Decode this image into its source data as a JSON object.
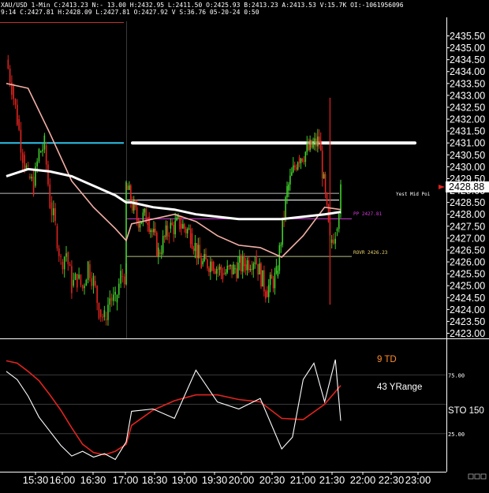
{
  "header": {
    "line1": "XAU/USD  1-Min  C:2413.23  N:- 13.00  H:2432.95  L:2411.50  O:2425.93  B:2413.23  A:2413.53  V:15.7K  OI:-1061956096",
    "line2": "9:14  C:2427.81  H:2428.09  L:2427.81  O:2427.92  V  S:36.76  05-20-24  0:50"
  },
  "price_axis": {
    "ticks": [
      "2423.00",
      "2423.50",
      "2424.00",
      "2424.50",
      "2425.00",
      "2425.50",
      "2426.00",
      "2426.50",
      "2427.00",
      "2427.50",
      "2428.00",
      "2428.50",
      "2429.00",
      "2429.50",
      "2430.00",
      "2430.50",
      "2431.00",
      "2431.50",
      "2432.00",
      "2432.50",
      "2433.00",
      "2433.50",
      "2434.00",
      "2434.50",
      "2435.00",
      "2435.50"
    ],
    "current_price": "2428.88"
  },
  "time_axis": {
    "ticks": [
      "15:30",
      "16:00",
      "16:30",
      "17:00",
      "18:30",
      "19:00",
      "19:30",
      "20:00",
      "20:30",
      "21:00",
      "21:30",
      "22:00",
      "22:30",
      "23:00"
    ]
  },
  "annotations": {
    "yest_mid": "Yest Mid Poi",
    "pp": "PP 2427.81",
    "rovr": "ROVR 2426.23",
    "td": "9 TD",
    "yrange": "43 YRange",
    "sto": "STO  150"
  },
  "oscillator_axis": {
    "ticks": [
      "75.00",
      "25.00"
    ]
  },
  "colors": {
    "up": "#3fcf2c",
    "down": "#e0241f",
    "ma_slow": "#ffffff",
    "ma_fast": "#f4b0a6",
    "cyan_level": "#2fc2e8",
    "pp_level": "#d13bd6",
    "td_label": "#ff8c28"
  },
  "chart_data": [
    {
      "type": "line",
      "symbol": "XAU/USD",
      "interval": "1-Min",
      "ylim": [
        2423.0,
        2435.5
      ],
      "levels": {
        "white_thick_level": 2431.0,
        "cyan_level": 2431.0,
        "yest_mid_point": 2428.88,
        "pp": 2427.81,
        "rovr": 2426.23
      },
      "series": [
        {
          "x": [
            "15:10",
            "15:15",
            "15:20",
            "15:25",
            "15:30",
            "15:35",
            "15:40",
            "15:45",
            "15:50",
            "15:55",
            "16:00",
            "16:05",
            "16:10",
            "16:15",
            "16:20",
            "16:25",
            "16:30",
            "16:35",
            "16:40",
            "16:45",
            "16:50",
            "16:55",
            "17:00",
            "18:15",
            "18:25",
            "18:35",
            "18:45",
            "18:55",
            "19:05",
            "19:15",
            "19:25",
            "19:35",
            "19:45",
            "19:55",
            "20:05",
            "20:15",
            "20:25",
            "20:35",
            "20:45",
            "20:55",
            "21:05",
            "21:15",
            "21:25",
            "21:30",
            "21:35"
          ],
          "values": [
            2434.5,
            2433.4,
            2432.0,
            2430.5,
            2429.6,
            2429.2,
            2430.6,
            2430.9,
            2428.5,
            2427.5,
            2426.0,
            2426.4,
            2425.0,
            2425.3,
            2424.9,
            2425.9,
            2425.2,
            2424.0,
            2423.6,
            2424.5,
            2424.3,
            2425.4,
            2425.5,
            2429.2,
            2427.8,
            2427.9,
            2426.4,
            2427.4,
            2427.6,
            2427.2,
            2425.9,
            2426.0,
            2425.5,
            2425.7,
            2425.9,
            2426.2,
            2424.8,
            2425.4,
            2429.0,
            2430.4,
            2430.7,
            2431.1,
            2426.8,
            2427.3,
            2428.9
          ]
        },
        {
          "x": [
            "15:10",
            "15:30",
            "15:50",
            "16:10",
            "16:30",
            "16:50",
            "17:00",
            "18:20",
            "18:40",
            "19:00",
            "19:20",
            "19:40",
            "20:00",
            "20:20",
            "20:40",
            "21:00",
            "21:20",
            "21:35"
          ],
          "values": [
            2429.6,
            2429.9,
            2429.8,
            2429.6,
            2429.2,
            2428.8,
            2428.5,
            2428.5,
            2428.3,
            2428.2,
            2428.0,
            2427.9,
            2427.8,
            2427.8,
            2427.8,
            2427.9,
            2428.0,
            2428.1
          ]
        },
        {
          "x": [
            "15:10",
            "15:30",
            "15:50",
            "16:10",
            "16:30",
            "16:50",
            "17:00",
            "18:20",
            "18:40",
            "19:00",
            "19:20",
            "19:40",
            "20:00",
            "20:20",
            "20:40",
            "21:00",
            "21:20",
            "21:35"
          ],
          "values": [
            2433.5,
            2433.3,
            2431.4,
            2429.4,
            2428.3,
            2427.4,
            2426.9,
            2427.6,
            2427.8,
            2428.0,
            2427.7,
            2427.1,
            2426.7,
            2426.6,
            2426.2,
            2427.1,
            2428.3,
            2428.2
          ]
        }
      ]
    },
    {
      "type": "line",
      "name": "STO",
      "ylim": [
        0,
        100
      ],
      "series": [
        {
          "x": [
            "15:10",
            "15:20",
            "15:30",
            "15:40",
            "15:50",
            "16:00",
            "16:10",
            "16:20",
            "16:30",
            "16:40",
            "16:50",
            "17:00",
            "18:20",
            "18:40",
            "19:00",
            "19:20",
            "19:40",
            "20:00",
            "20:20",
            "20:40",
            "20:50",
            "21:00",
            "21:10",
            "21:20",
            "21:30",
            "21:35"
          ],
          "values": [
            78,
            71,
            57,
            39,
            27,
            15,
            6,
            10,
            5,
            8,
            3,
            18,
            44,
            46,
            38,
            79,
            52,
            46,
            55,
            12,
            22,
            71,
            85,
            52,
            88,
            36
          ]
        },
        {
          "x": [
            "15:10",
            "15:20",
            "15:30",
            "15:40",
            "15:50",
            "16:00",
            "16:10",
            "16:20",
            "16:30",
            "16:40",
            "16:50",
            "17:00",
            "18:20",
            "18:40",
            "19:00",
            "19:20",
            "19:40",
            "20:00",
            "20:20",
            "20:40",
            "21:00",
            "21:20",
            "21:35"
          ],
          "values": [
            87,
            85,
            78,
            70,
            58,
            45,
            30,
            16,
            9,
            7,
            10,
            16,
            32,
            45,
            53,
            58,
            58,
            54,
            52,
            38,
            37,
            50,
            66
          ]
        }
      ]
    }
  ]
}
